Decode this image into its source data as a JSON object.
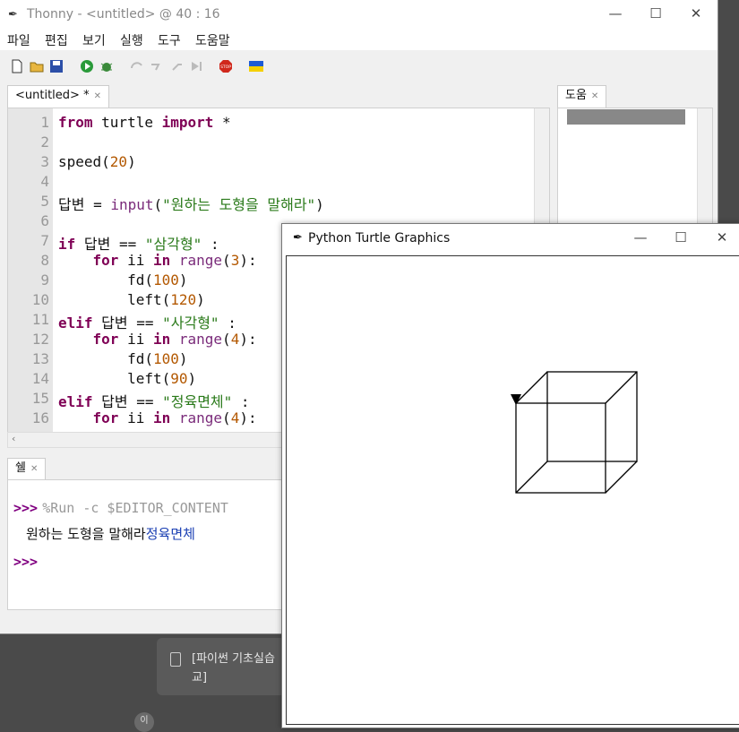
{
  "background": {
    "card_text": "[파이썬 기초실습 교]",
    "tiny_label": "",
    "circle_label": "이"
  },
  "thonny": {
    "title": "Thonny  -  <untitled>  @  40 : 16",
    "menu": [
      "파일",
      "편집",
      "보기",
      "실행",
      "도구",
      "도움말"
    ],
    "editor_tab": "<untitled>  *",
    "help_tab": "도움",
    "shell_tab": "쉘",
    "line_numbers": [
      "1",
      "2",
      "3",
      "4",
      "5",
      "6",
      "7",
      "8",
      "9",
      "10",
      "11",
      "12",
      "13",
      "14",
      "15",
      "16"
    ],
    "code": [
      "from turtle import *",
      "",
      "speed(20)",
      "",
      "답변 = input(\"원하는 도형을 말해라\")",
      "",
      "if 답변 == \"삼각형\" :",
      "    for ii in range(3):",
      "        fd(100)",
      "        left(120)",
      "elif 답변 == \"사각형\" :",
      "    for ii in range(4):",
      "        fd(100)",
      "        left(90)",
      "elif 답변 == \"정육면체\" :",
      "    for ii in range(4):"
    ],
    "shell": {
      "prompt": ">>>",
      "command": "%Run -c $EDITOR_CONTENT",
      "output_prefix": "원하는 도형을 말해라",
      "user_input": "정육면체"
    }
  },
  "turtle": {
    "title": "Python Turtle Graphics"
  },
  "colors": {
    "keyword": "#7f0055",
    "string": "#2a7a1a",
    "number": "#b35800",
    "prompt": "#800080"
  }
}
